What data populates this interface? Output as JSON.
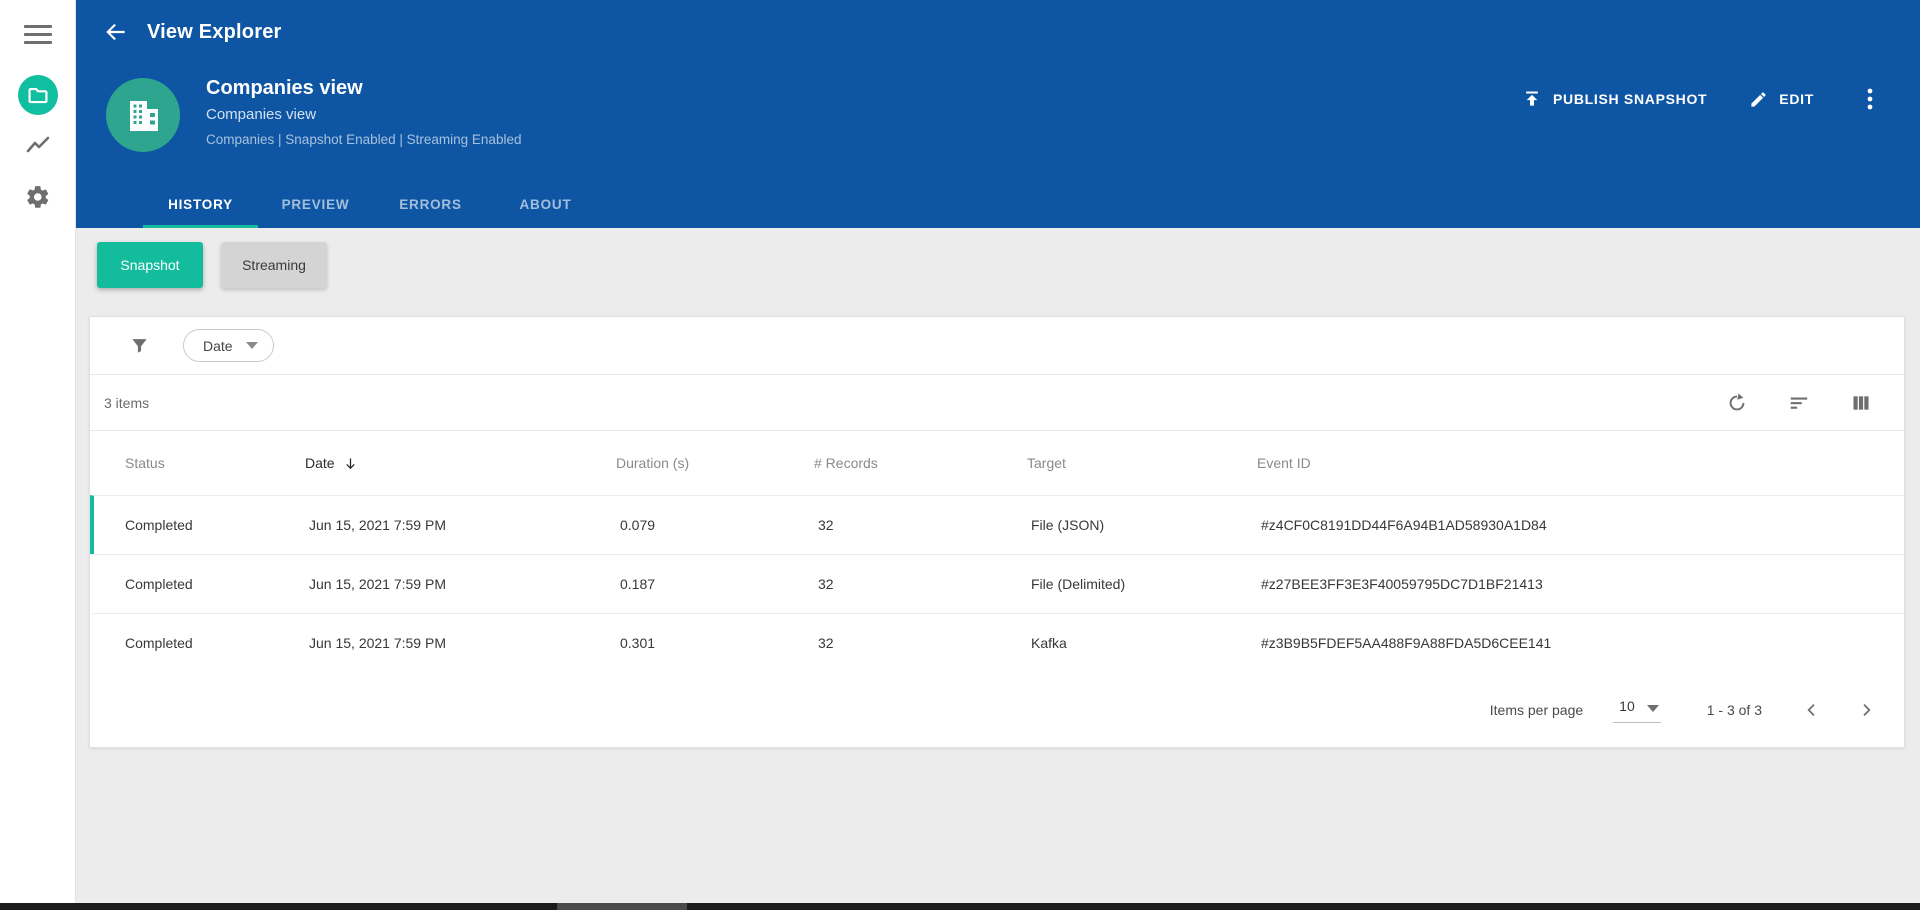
{
  "colors": {
    "header_blue": "#0E56A4",
    "teal_accent": "#14BC9E",
    "avatar_teal": "#2EA68F",
    "rail_icon_teal": "#10BEA0",
    "page_bg": "#ECECEC"
  },
  "sidebar": {
    "items": [
      {
        "name": "menu"
      },
      {
        "name": "views",
        "active": true
      },
      {
        "name": "metrics"
      },
      {
        "name": "settings"
      }
    ]
  },
  "topbar": {
    "title": "View Explorer"
  },
  "view_header": {
    "title": "Companies view",
    "subtitle": "Companies view",
    "meta": "Companies | Snapshot Enabled | Streaming Enabled",
    "publish_label": "PUBLISH SNAPSHOT",
    "edit_label": "EDIT"
  },
  "tabs": {
    "history": "HISTORY",
    "preview": "PREVIEW",
    "errors": "ERRORS",
    "about": "ABOUT",
    "active": "HISTORY"
  },
  "mode_toggle": {
    "snapshot": "Snapshot",
    "streaming": "Streaming",
    "active": "Snapshot"
  },
  "filter_bar": {
    "dropdown_label": "Date"
  },
  "table": {
    "items_count": "3 items",
    "columns": {
      "status": "Status",
      "date": "Date",
      "duration": "Duration (s)",
      "records": "# Records",
      "target": "Target",
      "event_id": "Event ID"
    },
    "sorted_by": "Date",
    "sort_direction": "desc",
    "rows": [
      {
        "status": "Completed",
        "date": "Jun 15, 2021 7:59 PM",
        "duration": "0.079",
        "records": "32",
        "target": "File (JSON)",
        "event_id": "#z4CF0C8191DD44F6A94B1AD58930A1D84"
      },
      {
        "status": "Completed",
        "date": "Jun 15, 2021 7:59 PM",
        "duration": "0.187",
        "records": "32",
        "target": "File (Delimited)",
        "event_id": "#z27BEE3FF3E3F40059795DC7D1BF21413"
      },
      {
        "status": "Completed",
        "date": "Jun 15, 2021 7:59 PM",
        "duration": "0.301",
        "records": "32",
        "target": "Kafka",
        "event_id": "#z3B9B5FDEF5AA488F9A88FDA5D6CEE141"
      }
    ]
  },
  "pagination": {
    "items_per_page_label": "Items per page",
    "page_size": "10",
    "range": "1 - 3 of 3"
  }
}
